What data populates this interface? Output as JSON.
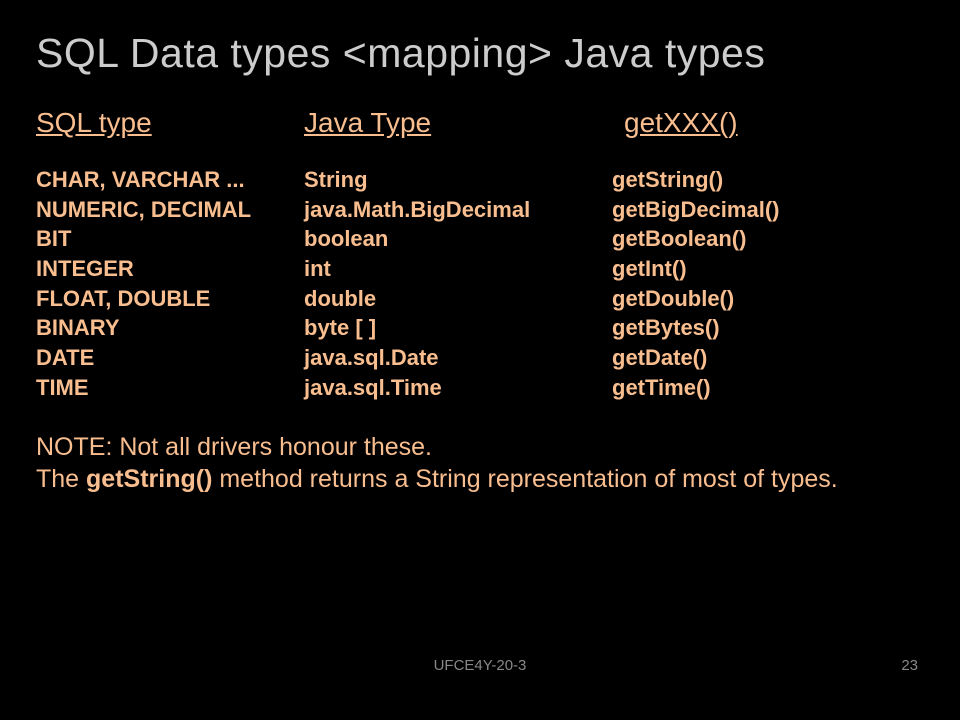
{
  "slide": {
    "title": "SQL Data types <mapping> Java types",
    "headers": {
      "col1": "SQL  type",
      "col2": "Java Type",
      "col3": "getXXX()"
    },
    "rows": [
      {
        "sql": "CHAR, VARCHAR ...",
        "java": "String",
        "get": "getString()"
      },
      {
        "sql": "NUMERIC, DECIMAL",
        "java": "java.Math.BigDecimal",
        "get": "getBigDecimal()"
      },
      {
        "sql": "BIT",
        "java": "boolean",
        "get": "getBoolean()"
      },
      {
        "sql": "INTEGER",
        "java": "int",
        "get": "getInt()"
      },
      {
        "sql": "FLOAT, DOUBLE",
        "java": "double",
        "get": "getDouble()"
      },
      {
        "sql": "BINARY",
        "java": "byte [ ]",
        "get": "getBytes()"
      },
      {
        "sql": "DATE",
        "java": "java.sql.Date",
        "get": "getDate()"
      },
      {
        "sql": "TIME",
        "java": "java.sql.Time",
        "get": "getTime()"
      }
    ],
    "note_line1": "NOTE: Not all drivers honour these.",
    "note_line2a": "The ",
    "note_line2b": "getString()",
    "note_line2c": " method returns a String representation of most of types.",
    "footer_code": "UFCE4Y-20-3",
    "page_number": "23"
  }
}
